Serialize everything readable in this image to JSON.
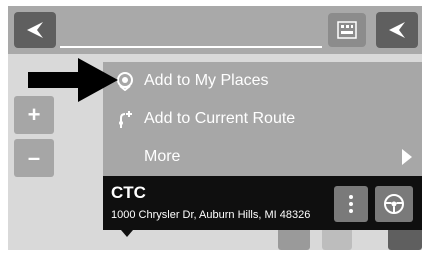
{
  "menu": {
    "items": [
      {
        "label": "Add to My Places",
        "icon": "favorite-place-icon"
      },
      {
        "label": "Add to Current Route",
        "icon": "add-route-icon"
      },
      {
        "label": "More",
        "icon": "chevron-right-icon"
      }
    ]
  },
  "zoom": {
    "in_label": "+",
    "out_label": "–"
  },
  "place": {
    "name": "CTC",
    "address": "1000 Chrysler Dr, Auburn Hills, MI 48326"
  },
  "colors": {
    "topbar": "#a9a9a9",
    "menu_bg": "#a7a7a7",
    "info_bg": "#0f0f0f",
    "button_dark": "#5f5f5f"
  }
}
